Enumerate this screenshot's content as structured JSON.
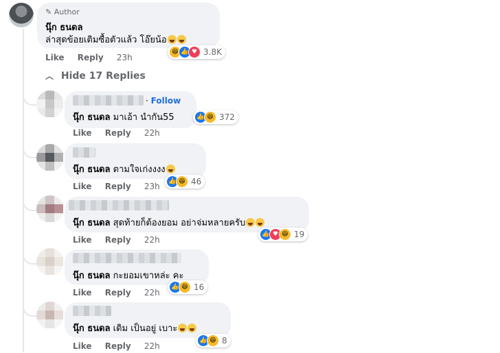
{
  "author": {
    "badge_label": "Author",
    "name": "นุ๊ก ธนดล",
    "text": "ล่าสุดข้อยเติมซื้อตัวแล้ว โอ๊ยน้อ",
    "like_label": "Like",
    "reply_label": "Reply",
    "time": "23h",
    "reaction_count": "3.8K",
    "reactions": [
      "haha-icon",
      "like-icon",
      "love-icon"
    ]
  },
  "hide_replies_label": "Hide 17 Replies",
  "replies": [
    {
      "name": "นุ๊ก ธนดล",
      "text": "มาเอ้า นำกัน55",
      "follow_label": "Follow",
      "like_label": "Like",
      "reply_label": "Reply",
      "time": "22h",
      "reaction_count": "372",
      "reactions": [
        "like-icon",
        "haha-icon"
      ]
    },
    {
      "name": "นุ๊ก ธนดล",
      "text": "ตามใจเก่งงงง",
      "like_label": "Like",
      "reply_label": "Reply",
      "time": "23h",
      "reaction_count": "46",
      "reactions": [
        "like-icon",
        "haha-icon"
      ]
    },
    {
      "name": "นุ๊ก ธนดล",
      "text": "สุดท้ายก็ต้องยอม อย่าจ่มหลายครับ",
      "like_label": "Like",
      "reply_label": "Reply",
      "time": "22h",
      "reaction_count": "19",
      "reactions": [
        "like-icon",
        "love-icon",
        "haha-icon"
      ]
    },
    {
      "name": "นุ๊ก ธนดล",
      "text": "กะยอมเขาหล่ะ คะ",
      "like_label": "Like",
      "reply_label": "Reply",
      "time": "22h",
      "reaction_count": "16",
      "reactions": [
        "like-icon",
        "haha-icon"
      ]
    },
    {
      "name": "นุ๊ก ธนดล",
      "text": "เดิม เป็นอยู่ เบาะ",
      "like_label": "Like",
      "reply_label": "Reply",
      "time": "22h",
      "reaction_count": "8",
      "reactions": [
        "like-icon",
        "haha-icon"
      ]
    }
  ],
  "colors": {
    "link": "#216fdb",
    "muted": "#65676b",
    "bubble": "#f0f2f5",
    "like": "#1877f2",
    "haha": "#f7b928",
    "love": "#f33e58"
  }
}
